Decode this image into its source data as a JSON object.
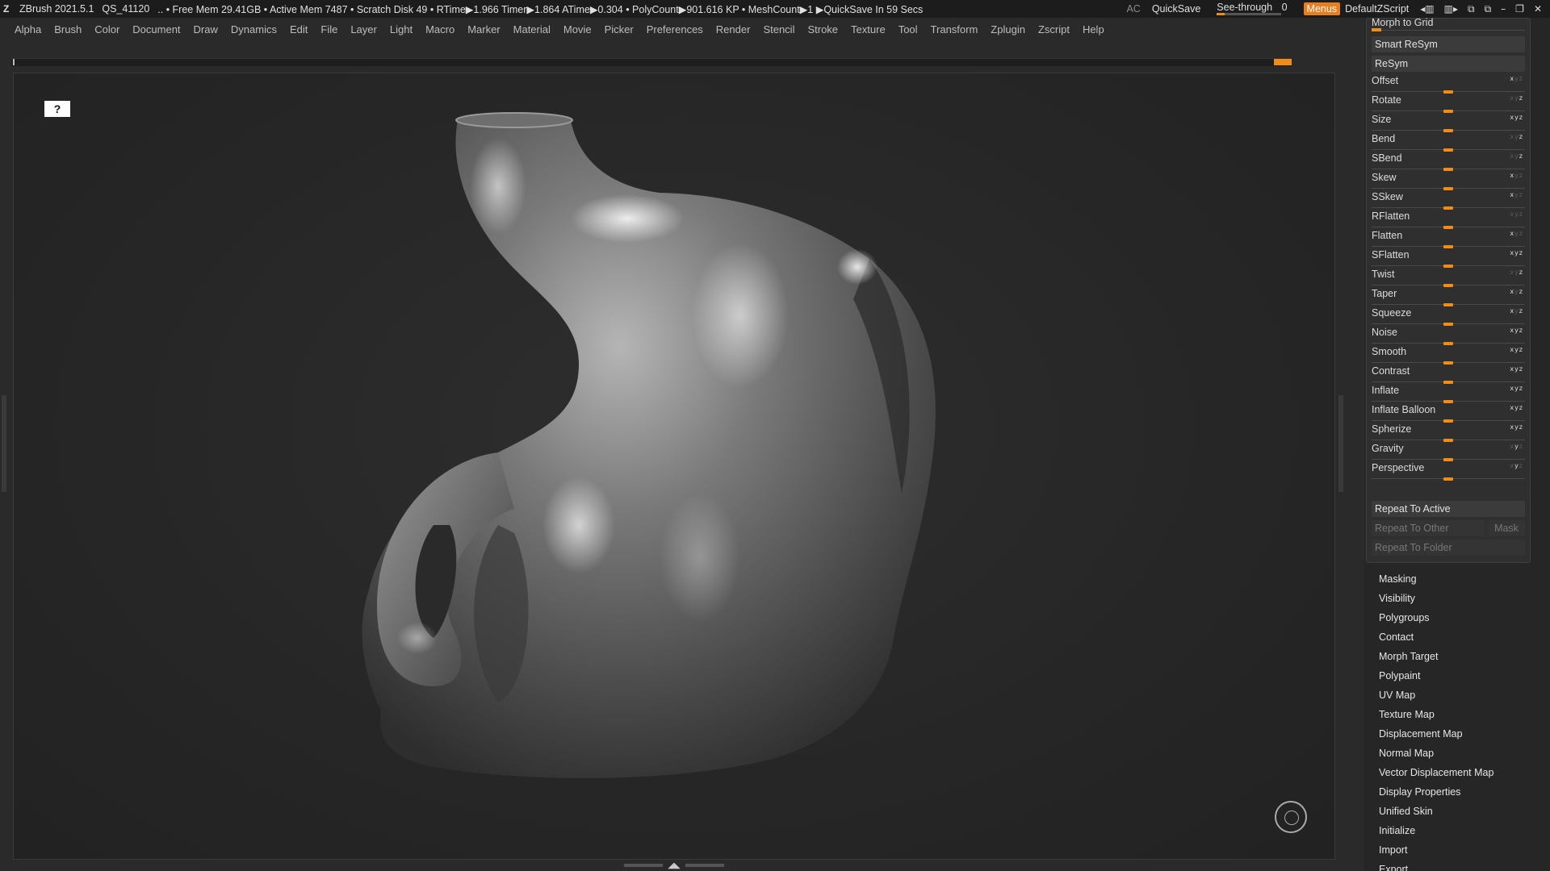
{
  "titlebar": {
    "app": "ZBrush 2021.5.1",
    "doc": "QS_41120",
    "stats": ".. • Free Mem 29.41GB • Active Mem 7487 • Scratch Disk 49 •  RTime▶1.966 Timer▶1.864 ATime▶0.304 • PolyCount▶901.616 KP  • MeshCount▶1  ▶QuickSave In 59 Secs",
    "ac": "AC",
    "quicksave": "QuickSave",
    "seethrough_label": "See-through",
    "seethrough_value": "0",
    "menus": "Menus",
    "script": "DefaultZScript"
  },
  "menubar": [
    "Alpha",
    "Brush",
    "Color",
    "Document",
    "Draw",
    "Dynamics",
    "Edit",
    "File",
    "Layer",
    "Light",
    "Macro",
    "Marker",
    "Material",
    "Movie",
    "Picker",
    "Preferences",
    "Render",
    "Stencil",
    "Stroke",
    "Texture",
    "Tool",
    "Transform",
    "Zplugin",
    "Zscript",
    "Help"
  ],
  "deformation": {
    "morph_to_grid": "Morph to Grid",
    "smart_resym": "Smart ReSym",
    "resym": "ReSym",
    "sliders": [
      {
        "label": "Offset",
        "axes": [
          1,
          0,
          0
        ]
      },
      {
        "label": "Rotate",
        "axes": [
          0,
          0,
          1
        ]
      },
      {
        "label": "Size",
        "axes": [
          1,
          1,
          1
        ]
      },
      {
        "label": "Bend",
        "axes": [
          0,
          0,
          1
        ]
      },
      {
        "label": "SBend",
        "axes": [
          0,
          0,
          1
        ]
      },
      {
        "label": "Skew",
        "axes": [
          1,
          0,
          0
        ]
      },
      {
        "label": "SSkew",
        "axes": [
          1,
          0,
          0
        ]
      },
      {
        "label": "RFlatten",
        "axes": [
          0,
          0,
          0
        ]
      },
      {
        "label": "Flatten",
        "axes": [
          1,
          0,
          0
        ]
      },
      {
        "label": "SFlatten",
        "axes": [
          1,
          1,
          1
        ]
      },
      {
        "label": "Twist",
        "axes": [
          0,
          0,
          1
        ]
      },
      {
        "label": "Taper",
        "axes": [
          1,
          0,
          1
        ]
      },
      {
        "label": "Squeeze",
        "axes": [
          1,
          0,
          1
        ]
      },
      {
        "label": "Noise",
        "axes": [
          1,
          1,
          1
        ]
      },
      {
        "label": "Smooth",
        "axes": [
          1,
          1,
          1
        ]
      },
      {
        "label": "Contrast",
        "axes": [
          1,
          1,
          1
        ]
      },
      {
        "label": "Inflate",
        "axes": [
          1,
          1,
          1
        ]
      },
      {
        "label": "Inflate Balloon",
        "axes": [
          1,
          1,
          1
        ]
      },
      {
        "label": "Spherize",
        "axes": [
          1,
          1,
          1
        ]
      },
      {
        "label": "Gravity",
        "axes": [
          0,
          1,
          0
        ]
      },
      {
        "label": "Perspective",
        "axes": [
          0,
          1,
          0
        ]
      }
    ],
    "slider_value_fraction": 0.5,
    "repeat_to_active": "Repeat To Active",
    "repeat_to_other": "Repeat To Other",
    "mask": "Mask",
    "repeat_to_folder": "Repeat To Folder"
  },
  "subpalettes": [
    "Masking",
    "Visibility",
    "Polygroups",
    "Contact",
    "Morph Target",
    "Polypaint",
    "UV Map",
    "Texture Map",
    "Displacement Map",
    "Normal Map",
    "Vector Displacement Map",
    "Display Properties",
    "Unified Skin",
    "Initialize",
    "Import",
    "Export"
  ],
  "colors": {
    "accent": "#f08c1a",
    "menus_bg": "#e87e1e"
  }
}
